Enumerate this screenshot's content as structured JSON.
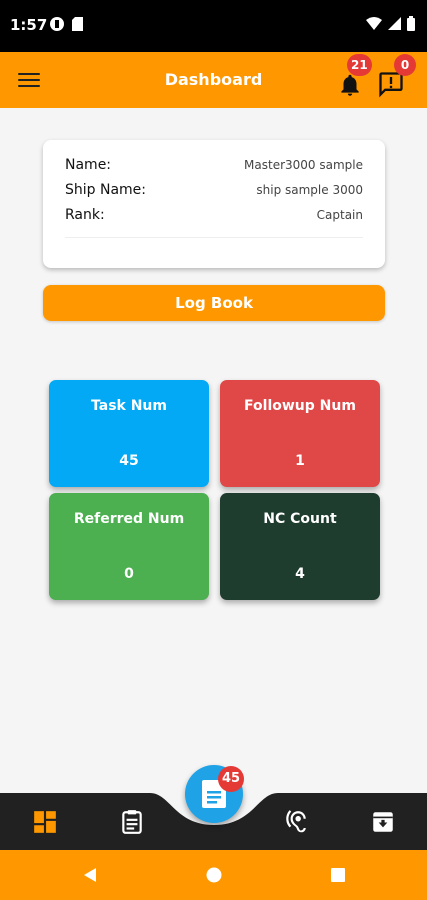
{
  "status_bar": {
    "time": "1:57"
  },
  "app_bar": {
    "title": "Dashboard",
    "bell_badge": "21",
    "message_badge": "0"
  },
  "profile": {
    "rows": [
      {
        "label": "Name:",
        "value": "Master3000 sample"
      },
      {
        "label": "Ship Name:",
        "value": "ship sample 3000"
      },
      {
        "label": "Rank:",
        "value": "Captain"
      }
    ]
  },
  "logbook_button": "Log Book",
  "tiles": [
    {
      "label": "Task Num",
      "value": "45",
      "color": "#03a9f4"
    },
    {
      "label": "Followup Num",
      "value": "1",
      "color": "#e04848"
    },
    {
      "label": "Referred Num",
      "value": "0",
      "color": "#4caf50"
    },
    {
      "label": "NC Count",
      "value": "4",
      "color": "#1f3d2e"
    }
  ],
  "fab": {
    "badge": "45",
    "icon": "document-icon"
  },
  "bottom_nav": {
    "items": [
      {
        "icon": "dashboard-icon",
        "active": true
      },
      {
        "icon": "clipboard-icon",
        "active": false
      },
      {
        "icon": "hearing-icon",
        "active": false
      },
      {
        "icon": "archive-icon",
        "active": false
      }
    ]
  },
  "colors": {
    "accent": "#ff9800",
    "badge": "#e53935",
    "nav_bg": "#212121",
    "fab": "#1fa2e6"
  }
}
